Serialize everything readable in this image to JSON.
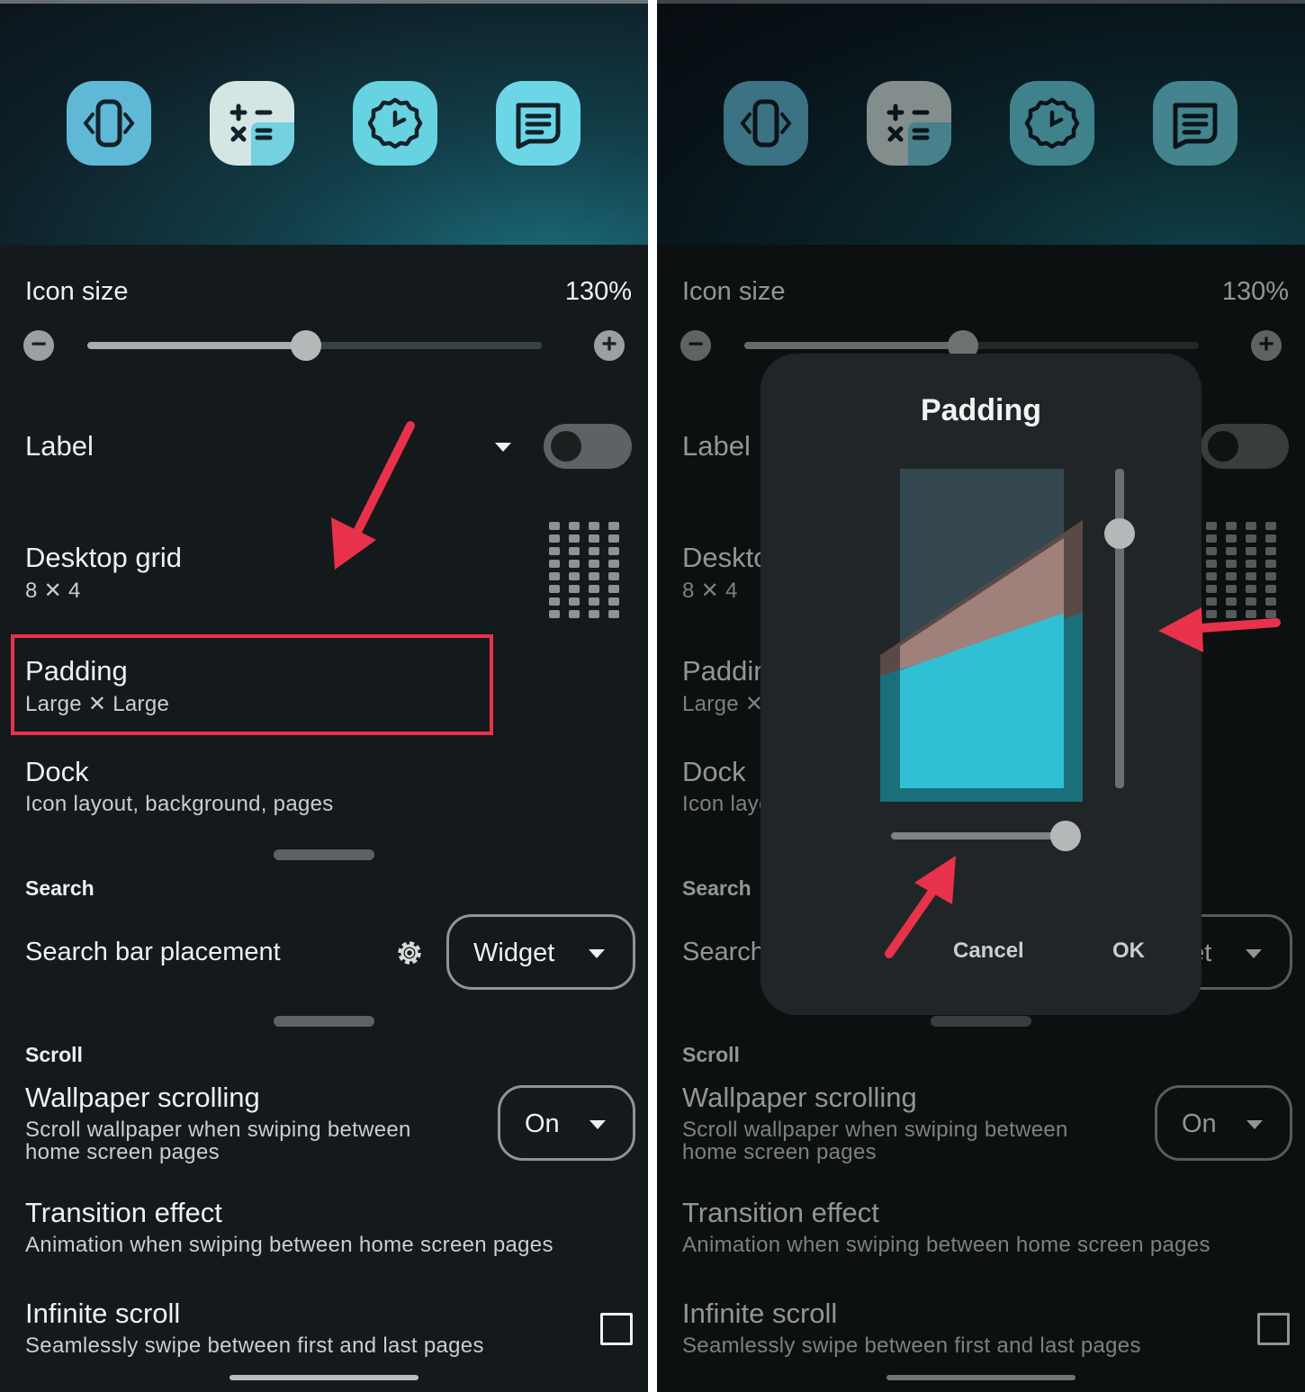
{
  "settings": {
    "icon_size": {
      "label": "Icon size",
      "value": "130%",
      "slider_fraction": 0.48
    },
    "label_row": {
      "label": "Label",
      "toggle_on": false
    },
    "desktop_grid": {
      "label": "Desktop grid",
      "value": "8 ✕ 4"
    },
    "padding": {
      "label": "Padding",
      "value": "Large ✕ Large"
    },
    "dock": {
      "label": "Dock",
      "description": "Icon layout, background, pages"
    },
    "search_section": "Search",
    "search_bar_placement": {
      "label": "Search bar placement",
      "value": "Widget"
    },
    "scroll_section": "Scroll",
    "wallpaper_scrolling": {
      "label": "Wallpaper scrolling",
      "description_line1": "Scroll wallpaper when swiping between",
      "description_line2": "home screen pages",
      "value": "On"
    },
    "transition_effect": {
      "label": "Transition effect",
      "description": "Animation when swiping between home screen pages"
    },
    "infinite_scroll": {
      "label": "Infinite scroll",
      "description": "Seamlessly swipe between first and last pages",
      "checked": false
    }
  },
  "dialog": {
    "title": "Padding",
    "cancel_label": "Cancel",
    "ok_label": "OK",
    "vertical_slider_fraction": 0.8,
    "horizontal_slider_fraction": 1.0
  },
  "icons": [
    "rotate-icon",
    "calculator-icon",
    "clock-icon",
    "message-icon",
    "minus-icon",
    "plus-icon",
    "dropdown-icon",
    "grid-icon",
    "gear-icon",
    "checkbox-icon"
  ],
  "colors": {
    "accent_highlight": "#e8324b",
    "preview_cyan": "#31c0d3",
    "preview_pink": "#a0807a"
  }
}
